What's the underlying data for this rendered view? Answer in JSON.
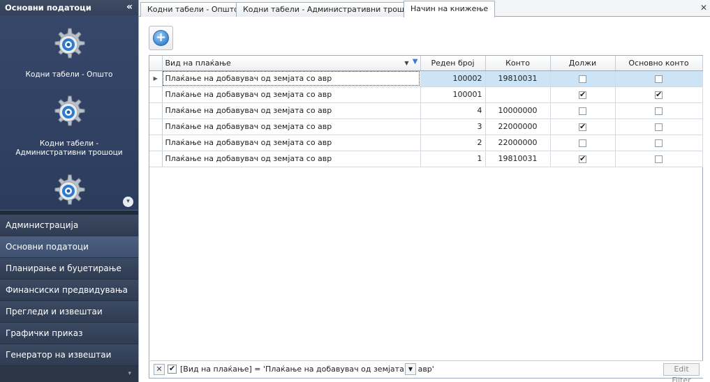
{
  "sidebar": {
    "header": "Основни податоци",
    "collapse_icon": "«",
    "gallery": [
      {
        "label": "Кодни табели - Општо",
        "icon": "gear-icon"
      },
      {
        "label": "Кодни табели - Административни трошоци",
        "icon": "gear-icon"
      },
      {
        "label": "",
        "icon": "gear-icon"
      }
    ],
    "scroll_icon": "▾",
    "nav": [
      {
        "label": "Администрација",
        "active": false
      },
      {
        "label": "Основни податоци",
        "active": true
      },
      {
        "label": "Планирање и буџетирање",
        "active": false
      },
      {
        "label": "Финансиски предвидувања",
        "active": false
      },
      {
        "label": "Прегледи и извештаи",
        "active": false
      },
      {
        "label": "Графички приказ",
        "active": false
      },
      {
        "label": "Генератор на извештаи",
        "active": false
      }
    ],
    "footer_icon": "▾"
  },
  "tabs": [
    {
      "label": "Кодни табели - Општо",
      "active": false
    },
    {
      "label": "Кодни табели - Административни трошоци",
      "active": false
    },
    {
      "label": "Начин на книжење",
      "active": true
    }
  ],
  "close_icon": "✕",
  "toolbar": {
    "add_icon": "+"
  },
  "grid": {
    "columns": [
      "Вид на плаќање",
      "Реден број",
      "Конто",
      "Должи",
      "Основно конто"
    ],
    "rows": [
      {
        "vid": "Плаќање на добавувач од земјата со авр",
        "reden": "100002",
        "konto": "19810031",
        "dolzi": false,
        "osnovno": false,
        "selected": true
      },
      {
        "vid": "Плаќање на добавувач од земјата со авр",
        "reden": "100001",
        "konto": "",
        "dolzi": true,
        "osnovno": true,
        "selected": false
      },
      {
        "vid": "Плаќање на добавувач од земјата со авр",
        "reden": "4",
        "konto": "10000000",
        "dolzi": false,
        "osnovno": false,
        "selected": false
      },
      {
        "vid": "Плаќање на добавувач од земјата со авр",
        "reden": "3",
        "konto": "22000000",
        "dolzi": true,
        "osnovno": false,
        "selected": false
      },
      {
        "vid": "Плаќање на добавувач од земјата со авр",
        "reden": "2",
        "konto": "22000000",
        "dolzi": false,
        "osnovno": false,
        "selected": false
      },
      {
        "vid": "Плаќање на добавувач од земјата со авр",
        "reden": "1",
        "konto": "19810031",
        "dolzi": true,
        "osnovno": false,
        "selected": false
      }
    ]
  },
  "filter": {
    "clear_icon": "✕",
    "enabled": true,
    "text": "[Вид на плаќање] = 'Плаќање на добавувач од земјата со авр'",
    "edit_label": "Edit Filter"
  }
}
